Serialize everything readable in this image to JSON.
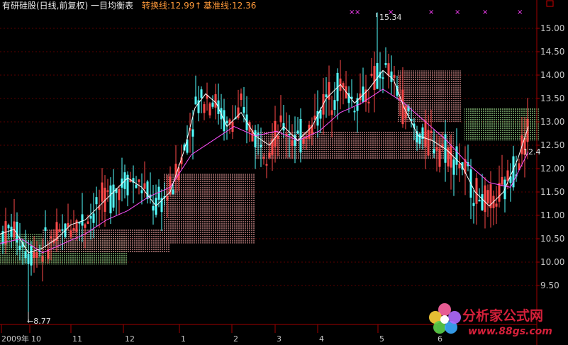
{
  "header": {
    "stock_label": "有研硅股(日线,前复权) 一目均衡表",
    "conversion_label": "转换线:",
    "conversion_value": "12.99",
    "base_label": "基准线:",
    "base_value": "12.36",
    "up_arrow": "↑"
  },
  "colors": {
    "background": "#000000",
    "grid": "#5a0000",
    "axis": "#a00000",
    "up_candle": "#ff4a4a",
    "down_candle": "#54ffff",
    "conversion_line": "#ffffff",
    "base_line": "#ff50ff",
    "cloud_bull": "#6f9a62",
    "cloud_bear": "#9e6a6a",
    "header_text": "#e8e8e8",
    "value_text": "#ff9a3a",
    "marker": "#ff40ff"
  },
  "chart_data": {
    "type": "candlestick",
    "title": "有研硅股(日线,前复权) 一目均衡表",
    "ylim": [
      9.0,
      15.5
    ],
    "y_ticks": [
      "15.00",
      "14.50",
      "14.00",
      "13.50",
      "13.00",
      "12.50",
      "12.00",
      "11.50",
      "11.00",
      "10.50",
      "10.00",
      "9.50"
    ],
    "y_tick_values": [
      15.0,
      14.5,
      14.0,
      13.5,
      13.0,
      12.5,
      12.0,
      11.5,
      11.0,
      10.5,
      10.0,
      9.5
    ],
    "x_labels": [
      "2009年",
      "10",
      "11",
      "12",
      "1",
      "2",
      "3",
      "4",
      "5",
      "6"
    ],
    "annotations": {
      "low_label": "8.77",
      "low_value": 8.77,
      "high_label": "15.34",
      "high_value": 15.34,
      "right_label": "12.4"
    },
    "top_markers": [
      "×",
      "×",
      "×",
      "×",
      "×",
      "×",
      "×"
    ],
    "current_values": {
      "conversion": 12.99,
      "base": 12.36
    },
    "candles": [],
    "conversion_series": [
      [
        0,
        10.6
      ],
      [
        20,
        10.7
      ],
      [
        40,
        10.2
      ],
      [
        60,
        10.3
      ],
      [
        80,
        10.5
      ],
      [
        100,
        10.8
      ],
      [
        120,
        10.9
      ],
      [
        140,
        11.2
      ],
      [
        160,
        11.5
      ],
      [
        180,
        11.8
      ],
      [
        200,
        11.6
      ],
      [
        220,
        11.2
      ],
      [
        240,
        11.5
      ],
      [
        260,
        12.4
      ],
      [
        275,
        13.3
      ],
      [
        290,
        13.6
      ],
      [
        305,
        13.4
      ],
      [
        320,
        12.9
      ],
      [
        340,
        13.2
      ],
      [
        360,
        12.7
      ],
      [
        380,
        12.5
      ],
      [
        400,
        12.9
      ],
      [
        420,
        12.6
      ],
      [
        440,
        12.9
      ],
      [
        460,
        13.5
      ],
      [
        480,
        13.8
      ],
      [
        500,
        13.4
      ],
      [
        520,
        13.7
      ],
      [
        540,
        14.1
      ],
      [
        555,
        13.9
      ],
      [
        570,
        13.3
      ],
      [
        590,
        12.7
      ],
      [
        610,
        12.6
      ],
      [
        630,
        12.4
      ],
      [
        650,
        12.1
      ],
      [
        670,
        11.5
      ],
      [
        690,
        11.2
      ],
      [
        710,
        11.5
      ],
      [
        730,
        12.2
      ],
      [
        745,
        12.9
      ]
    ],
    "base_series": [
      [
        0,
        10.4
      ],
      [
        30,
        10.5
      ],
      [
        60,
        10.2
      ],
      [
        90,
        10.4
      ],
      [
        120,
        10.6
      ],
      [
        150,
        10.9
      ],
      [
        180,
        11.1
      ],
      [
        210,
        11.4
      ],
      [
        240,
        11.6
      ],
      [
        270,
        12.3
      ],
      [
        300,
        12.6
      ],
      [
        330,
        12.9
      ],
      [
        360,
        12.7
      ],
      [
        390,
        12.8
      ],
      [
        420,
        12.6
      ],
      [
        450,
        12.8
      ],
      [
        480,
        13.2
      ],
      [
        510,
        13.4
      ],
      [
        540,
        13.7
      ],
      [
        570,
        13.4
      ],
      [
        600,
        13.0
      ],
      [
        630,
        12.6
      ],
      [
        660,
        12.1
      ],
      [
        690,
        11.7
      ],
      [
        720,
        11.6
      ],
      [
        745,
        12.36
      ]
    ],
    "cloud_segments": [
      {
        "x1": 0,
        "x2": 180,
        "top": 10.6,
        "bottom": 9.95,
        "kind": "bull"
      },
      {
        "x1": 60,
        "x2": 240,
        "top": 10.7,
        "bottom": 10.2,
        "kind": "bear"
      },
      {
        "x1": 230,
        "x2": 360,
        "top": 11.9,
        "bottom": 10.4,
        "kind": "bear"
      },
      {
        "x1": 360,
        "x2": 640,
        "top": 12.8,
        "bottom": 12.2,
        "kind": "bear"
      },
      {
        "x1": 560,
        "x2": 650,
        "top": 14.1,
        "bottom": 13.0,
        "kind": "bear"
      },
      {
        "x1": 655,
        "x2": 760,
        "top": 13.3,
        "bottom": 12.6,
        "kind": "bull"
      }
    ]
  },
  "watermark": {
    "text": "分析家公式网",
    "url": "www.88gs.com"
  }
}
